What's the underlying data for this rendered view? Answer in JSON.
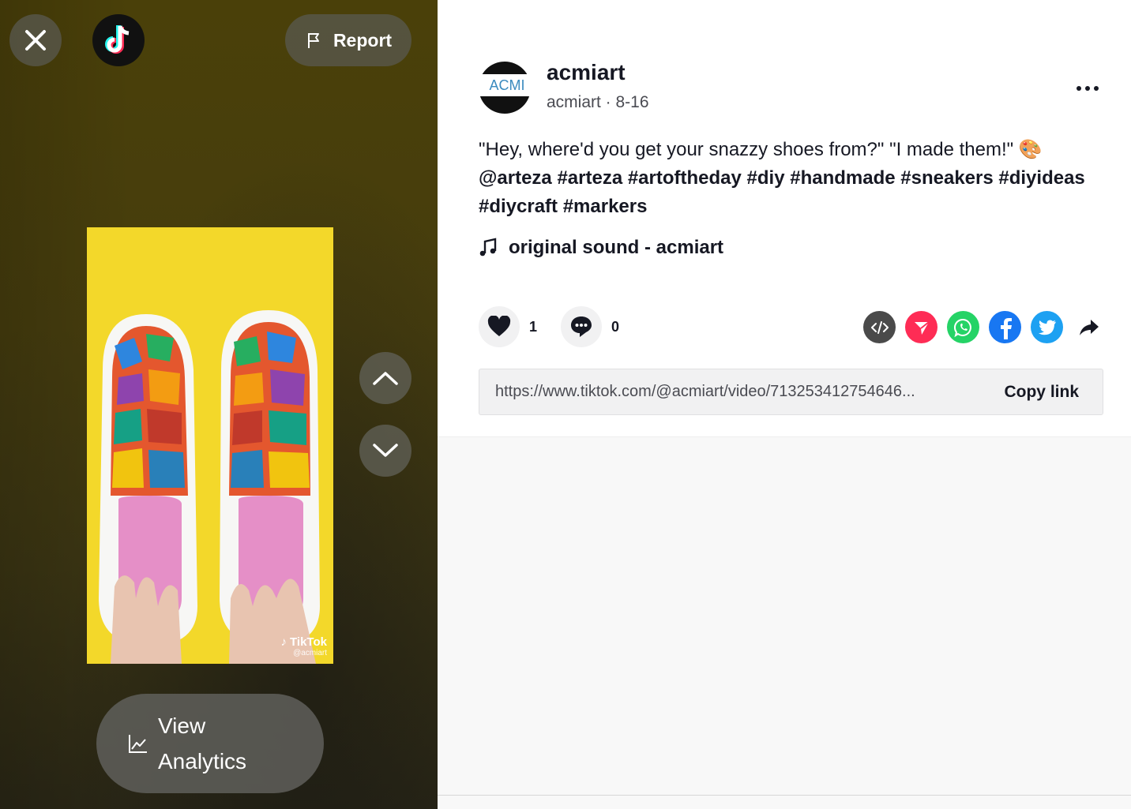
{
  "video_pane": {
    "report_label": "Report",
    "analytics_label": "View Analytics",
    "watermark_brand": "TikTok",
    "watermark_handle": "@acmiart"
  },
  "post": {
    "author_name": "acmiart",
    "author_meta": "acmiart · 8-16",
    "caption_text": "\"Hey, where'd you get your snazzy shoes from?\" \"I made them!\" 🎨",
    "caption_tags": "@arteza #arteza #artoftheday #diy #handmade #sneakers #diyideas #diycraft #markers",
    "sound": "original sound - acmiart",
    "likes": "1",
    "comments": "0",
    "url": "https://www.tiktok.com/@acmiart/video/713253412754646...",
    "copy_label": "Copy link",
    "avatar_text": "ACMI"
  },
  "share_icons": [
    "embed-icon",
    "send-icon",
    "whatsapp-icon",
    "facebook-icon",
    "twitter-icon",
    "share-arrow-icon"
  ],
  "colors": {
    "embed": "#4a4a4a",
    "send": "#fe2c55",
    "whatsapp": "#25d366",
    "facebook": "#1877f2",
    "twitter": "#1da1f2"
  }
}
